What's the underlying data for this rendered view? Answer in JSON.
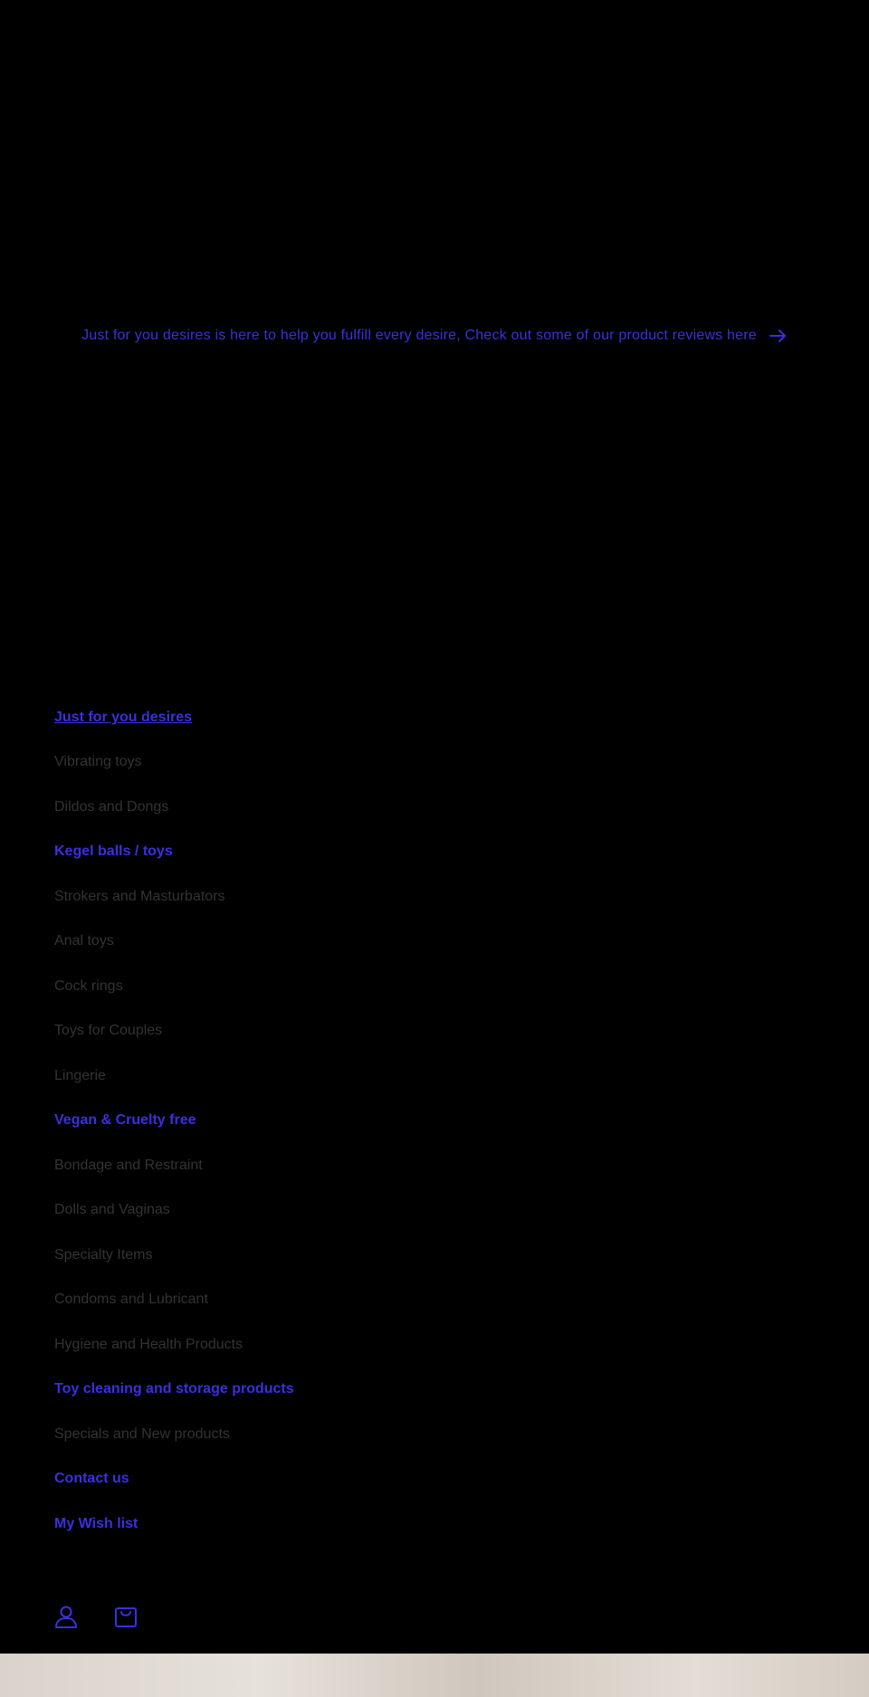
{
  "announcement": {
    "text": "Just for you desires is here to help you fulfill every desire, Check out some of our product reviews here",
    "icon": "arrow-right-icon"
  },
  "menu": {
    "items": [
      {
        "label": "Just for you desires",
        "state": "active"
      },
      {
        "label": "Vibrating toys",
        "state": "plain"
      },
      {
        "label": "Dildos and Dongs",
        "state": "plain"
      },
      {
        "label": "Kegel balls / toys",
        "state": "active"
      },
      {
        "label": "Strokers and Masturbators",
        "state": "plain"
      },
      {
        "label": "Anal toys",
        "state": "plain"
      },
      {
        "label": "Cock rings",
        "state": "plain"
      },
      {
        "label": "Toys for Couples",
        "state": "plain"
      },
      {
        "label": "Lingerie",
        "state": "plain"
      },
      {
        "label": "Vegan & Cruelty free",
        "state": "active"
      },
      {
        "label": "Bondage and Restraint",
        "state": "plain"
      },
      {
        "label": "Dolls and Vaginas",
        "state": "plain"
      },
      {
        "label": "Specialty Items",
        "state": "plain"
      },
      {
        "label": "Condoms and Lubricant",
        "state": "plain"
      },
      {
        "label": "Hygiene and Health Products",
        "state": "plain"
      },
      {
        "label": "Toy cleaning and storage products",
        "state": "active"
      },
      {
        "label": "Specials and New products",
        "state": "plain"
      },
      {
        "label": "Contact us",
        "state": "active"
      },
      {
        "label": "My Wish list",
        "state": "active"
      }
    ]
  },
  "icons": {
    "account": "account-icon",
    "cart": "cart-icon"
  },
  "colors": {
    "background": "#000000",
    "accent": "#3a30e0",
    "muted_text": "#333333"
  }
}
